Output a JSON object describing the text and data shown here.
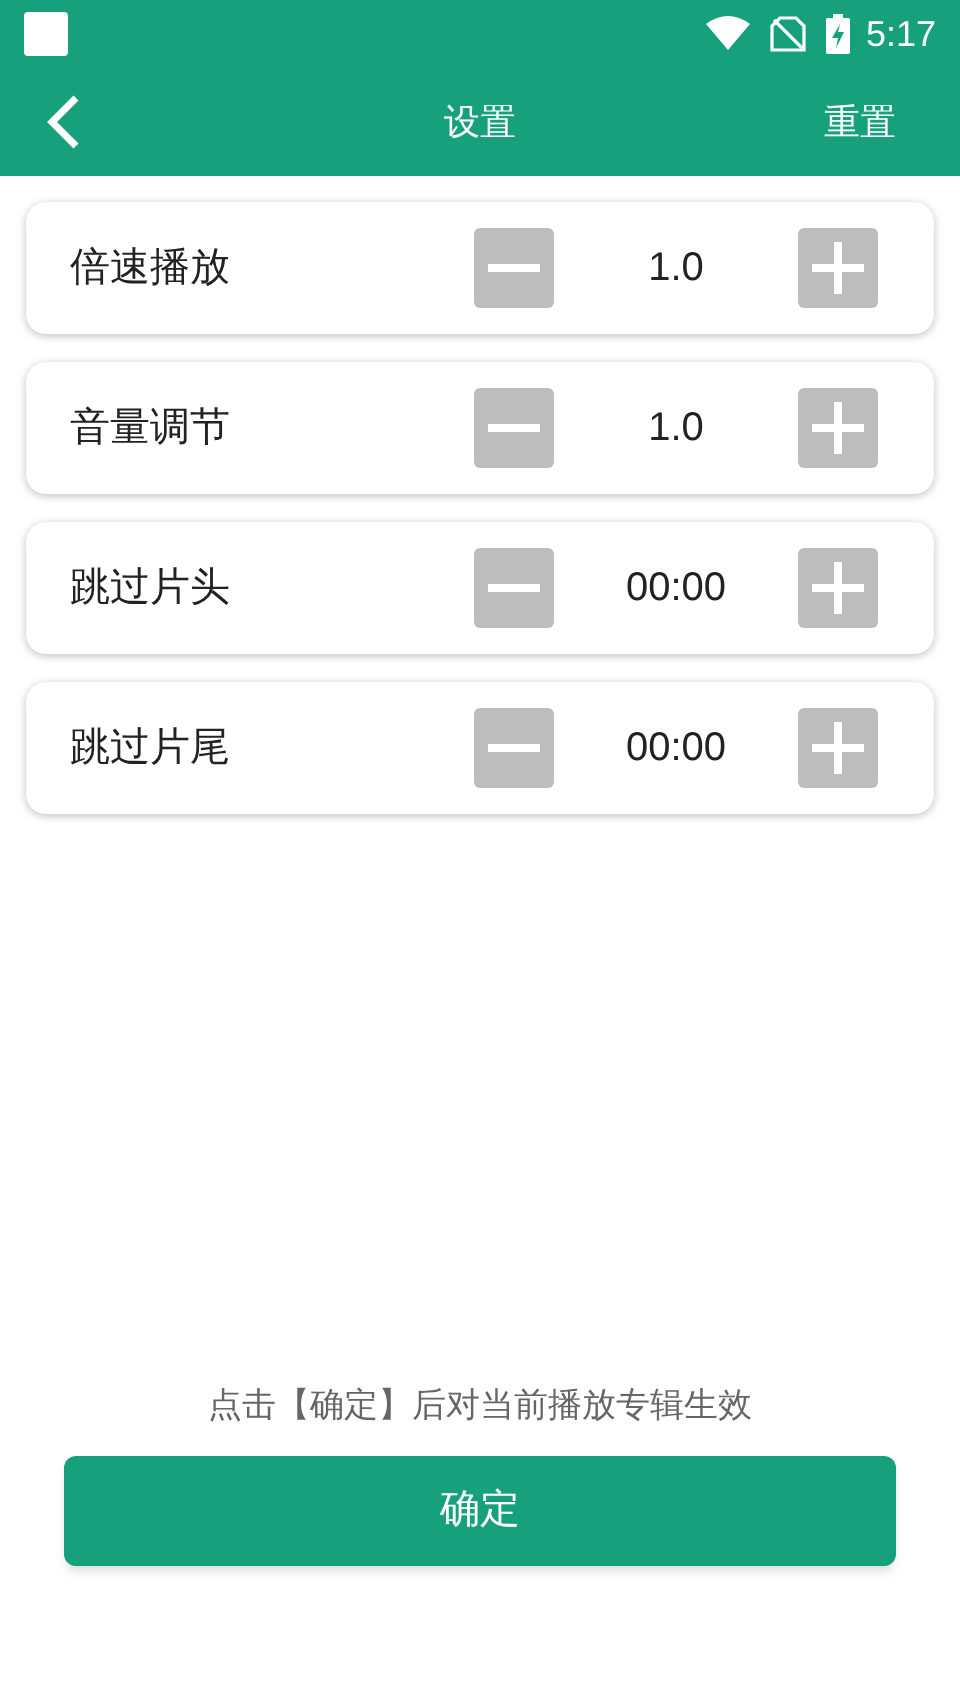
{
  "status_bar": {
    "time": "5:17"
  },
  "header": {
    "title": "设置",
    "action": "重置"
  },
  "settings": [
    {
      "label": "倍速播放",
      "value": "1.0"
    },
    {
      "label": "音量调节",
      "value": "1.0"
    },
    {
      "label": "跳过片头",
      "value": "00:00"
    },
    {
      "label": "跳过片尾",
      "value": "00:00"
    }
  ],
  "hint": "点击【确定】后对当前播放专辑生效",
  "confirm_button": "确定"
}
